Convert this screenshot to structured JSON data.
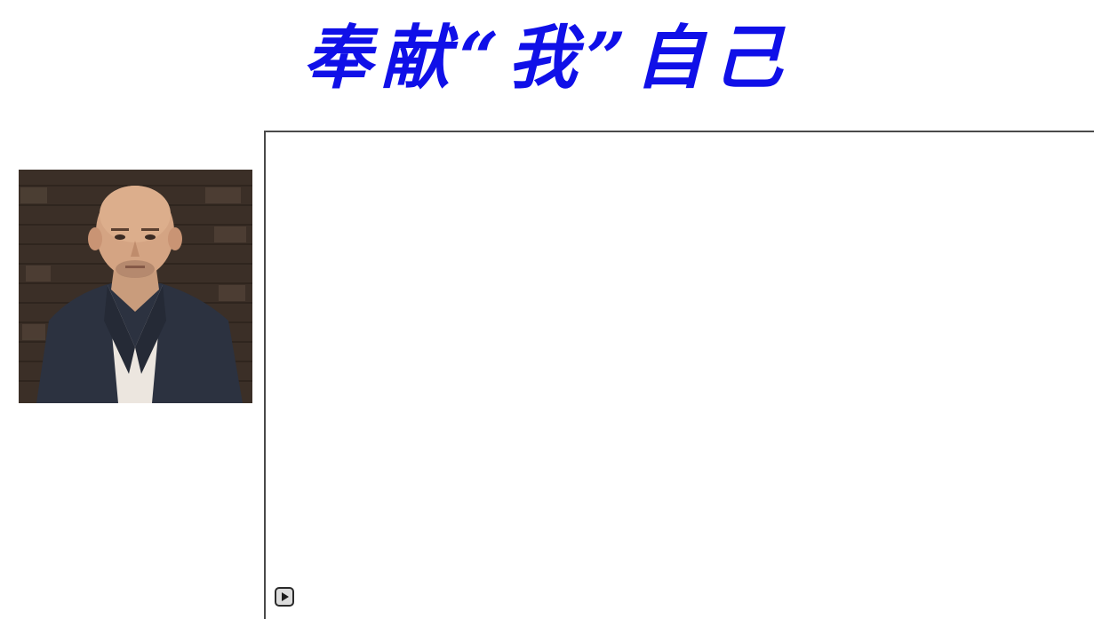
{
  "page": {
    "title": "奉献“我”自己"
  },
  "portrait": {
    "icon": "person-photo"
  },
  "media": {
    "play_icon": "play-icon"
  },
  "colors": {
    "title": "#1010e8",
    "frame_border": "#4a4a4a"
  }
}
